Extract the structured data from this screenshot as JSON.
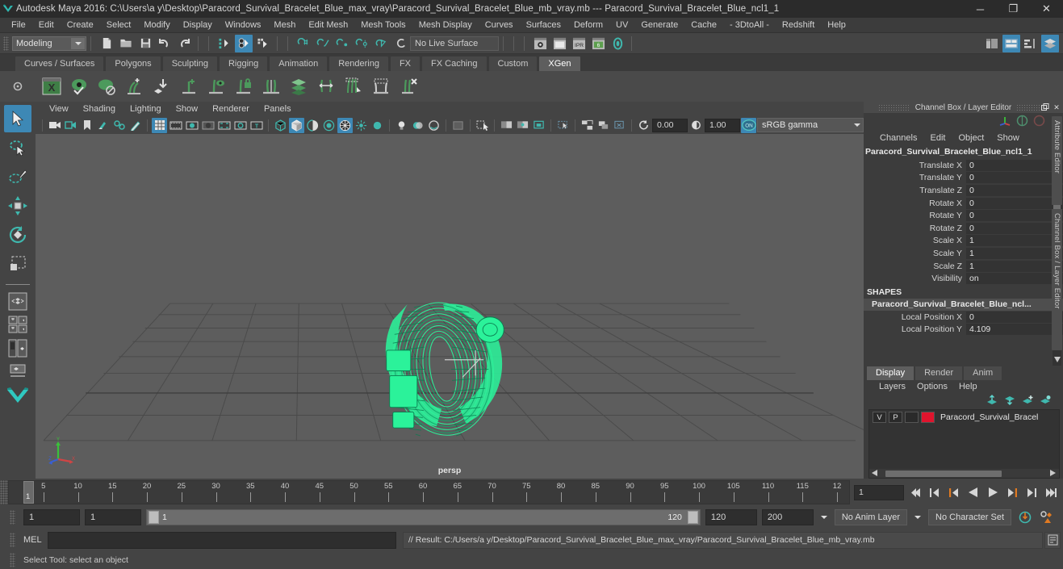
{
  "titlebar": {
    "app_icon": "maya-icon",
    "title": "Autodesk Maya 2016: C:\\Users\\a y\\Desktop\\Paracord_Survival_Bracelet_Blue_max_vray\\Paracord_Survival_Bracelet_Blue_mb_vray.mb  ---  Paracord_Survival_Bracelet_Blue_ncl1_1",
    "minimize": "─",
    "maximize": "❐",
    "close": "✕"
  },
  "menubar": {
    "items": [
      "File",
      "Edit",
      "Create",
      "Select",
      "Modify",
      "Display",
      "Windows",
      "Mesh",
      "Edit Mesh",
      "Mesh Tools",
      "Mesh Display",
      "Curves",
      "Surfaces",
      "Deform",
      "UV",
      "Generate",
      "Cache",
      "- 3DtoAll -",
      "Redshift",
      "Help"
    ]
  },
  "statusline": {
    "menuset": "Modeling",
    "live_surface": "No Live Surface",
    "numeric_input_a": "0.00",
    "numeric_input_b": "1.00",
    "color_space": "sRGB gamma",
    "icons": {
      "new_scene": "new-scene-icon",
      "open_scene": "open-scene-icon",
      "save_scene": "save-scene-icon",
      "undo": "undo-icon",
      "redo": "redo-icon",
      "select_hierarchy": "select-by-hierarchy-icon",
      "select_object": "select-by-object-type-icon",
      "select_component": "select-by-component-type-icon",
      "snap_grid": "snap-to-grid-icon",
      "snap_curve": "snap-to-curve-icon",
      "snap_point": "snap-to-point-icon",
      "snap_projected": "snap-to-projected-center-icon",
      "snap_view_plane": "snap-to-view-plane-icon",
      "make_live": "make-live-icon",
      "render_current": "render-current-frame-icon",
      "render_sequence": "render-sequence-icon",
      "ipr_render": "ipr-render-icon",
      "render_settings": "render-settings-icon",
      "hypershade": "hypershade-icon",
      "sidebar_toggle_attr": "show-attribute-editor-icon",
      "sidebar_toggle_tool": "show-tool-settings-icon",
      "sidebar_toggle_channel": "show-channel-box-icon"
    }
  },
  "shelf": {
    "tabs": [
      "Curves / Surfaces",
      "Polygons",
      "Sculpting",
      "Rigging",
      "Animation",
      "Rendering",
      "FX",
      "FX Caching",
      "Custom",
      "XGen"
    ],
    "active_tab": "XGen",
    "icons": [
      "xgen-window-icon",
      "xgen-preview-icon",
      "xgen-disable-preview-icon",
      "xgen-add-groom-icon",
      "xgen-place-icon",
      "xgen-add-density-icon",
      "xgen-show-guides-icon",
      "xgen-lock-guides-icon",
      "xgen-part-guides-icon",
      "xgen-layers-icon",
      "xgen-width-icon",
      "xgen-clump-icon",
      "xgen-region-icon",
      "xgen-delete-icon"
    ]
  },
  "toolbox": {
    "tools": [
      {
        "name": "select-tool-icon",
        "active": true
      },
      {
        "name": "lasso-select-tool-icon",
        "active": false
      },
      {
        "name": "paint-select-tool-icon",
        "active": false
      },
      {
        "name": "move-tool-icon",
        "active": false
      },
      {
        "name": "rotate-tool-icon",
        "active": false
      },
      {
        "name": "scale-tool-icon",
        "active": false
      }
    ],
    "layout_tools": [
      "single-perspective-view-icon",
      "four-view-layout-icon",
      "persp-outliner-layout-icon",
      "persp-graph-layout-icon"
    ]
  },
  "viewport": {
    "menus": [
      "View",
      "Shading",
      "Lighting",
      "Show",
      "Renderer",
      "Panels"
    ],
    "camera_label": "persp",
    "wireframe_color": "#2bf29a",
    "background_color": "#5d5d5d",
    "grid_color": "#4a4a4a",
    "toolbar_icons": [
      "select-camera-icon",
      "camera-attributes-icon",
      "bookmark-icon",
      "image-plane-icon",
      "two-d-pan-zoom-icon",
      "grease-pencil-icon",
      "grid-toggle-icon",
      "film-gate-icon",
      "resolution-gate-icon",
      "gate-mask-icon",
      "film-origin-icon",
      "field-chart-icon",
      "safe-title-icon",
      "wireframe-shading-icon",
      "smooth-shade-all-icon",
      "smooth-shade-selected-icon",
      "flat-shade-icon",
      "wireframe-on-shaded-icon",
      "use-default-material-icon",
      "shaded-texture-icon",
      "use-all-lights-icon",
      "shadows-icon",
      "ao-icon",
      "motion-blur-icon",
      "multisample-icon",
      "isolate-select-icon",
      "xray-icon",
      "xray-joints-icon",
      "xray-active-components-icon",
      "exposure-icon",
      "gamma-icon",
      "view-transform-enabled-icon"
    ],
    "exposure": "0.00",
    "gamma": "1.00",
    "view_transform": "sRGB gamma",
    "view_transform_toggle": "ON"
  },
  "channelbox": {
    "panel_title": "Channel Box / Layer Editor",
    "undock_icon": "undock-icon",
    "close_icon": "close-icon",
    "manip_icons": [
      "manipulator-icon",
      "no-manip-icon",
      "locator-icon"
    ],
    "menus": [
      "Channels",
      "Edit",
      "Object",
      "Show"
    ],
    "object_name": "Paracord_Survival_Bracelet_Blue_ncl1_1",
    "channels": [
      {
        "label": "Translate X",
        "value": "0"
      },
      {
        "label": "Translate Y",
        "value": "0"
      },
      {
        "label": "Translate Z",
        "value": "0"
      },
      {
        "label": "Rotate X",
        "value": "0"
      },
      {
        "label": "Rotate Y",
        "value": "0"
      },
      {
        "label": "Rotate Z",
        "value": "0"
      },
      {
        "label": "Scale X",
        "value": "1"
      },
      {
        "label": "Scale Y",
        "value": "1"
      },
      {
        "label": "Scale Z",
        "value": "1"
      },
      {
        "label": "Visibility",
        "value": "on"
      }
    ],
    "shapes_header": "SHAPES",
    "shape_name": "Paracord_Survival_Bracelet_Blue_ncl...",
    "shape_channels": [
      {
        "label": "Local Position X",
        "value": "0"
      },
      {
        "label": "Local Position Y",
        "value": "4.109"
      }
    ]
  },
  "layereditor": {
    "tabs": [
      "Display",
      "Render",
      "Anim"
    ],
    "active_tab": "Display",
    "menus": [
      "Layers",
      "Options",
      "Help"
    ],
    "toolbar_icons": [
      "move-layer-up-icon",
      "move-layer-down-icon",
      "new-layer-icon",
      "new-layer-from-selected-icon"
    ],
    "layers": [
      {
        "visibility": "V",
        "playback": "P",
        "shading": "",
        "color": "#e0142d",
        "name": "Paracord_Survival_Bracel"
      }
    ]
  },
  "right_tabs": [
    "Attribute Editor",
    "Channel Box / Layer Editor"
  ],
  "timeslider": {
    "tick_labels": [
      "5",
      "10",
      "15",
      "20",
      "25",
      "30",
      "35",
      "40",
      "45",
      "50",
      "55",
      "60",
      "65",
      "70",
      "75",
      "80",
      "85",
      "90",
      "95",
      "100",
      "105",
      "110",
      "115",
      "12"
    ],
    "current_frame_marker": "1",
    "current_frame_field": "1",
    "playback_icons": [
      "go-to-start-icon",
      "step-back-key-icon",
      "step-back-frame-icon",
      "play-backwards-icon",
      "play-forwards-icon",
      "step-forward-frame-icon",
      "step-forward-key-icon",
      "go-to-end-icon"
    ]
  },
  "rangeslider": {
    "anim_start": "1",
    "playback_start": "1",
    "range_start_label": "1",
    "range_end_label": "120",
    "playback_end": "120",
    "anim_end": "200",
    "anim_layer": "No Anim Layer",
    "character_set": "No Character Set",
    "auto_key_icon": "auto-keyframe-icon",
    "anim_prefs_icon": "animation-preferences-icon"
  },
  "commandline": {
    "language_label": "MEL",
    "input_value": "",
    "input_placeholder": "",
    "result_text": "// Result: C:/Users/a y/Desktop/Paracord_Survival_Bracelet_Blue_max_vray/Paracord_Survival_Bracelet_Blue_mb_vray.mb",
    "script_editor_icon": "script-editor-icon"
  },
  "helpline": {
    "text": "Select Tool: select an object"
  },
  "colors": {
    "accent_blue": "#3d88b5",
    "teal": "#3fb8ae",
    "xgen_green": "#4a9a5e",
    "wireframe_green": "#2bf29a",
    "layer_red": "#e0142d",
    "orange": "#e07a22"
  }
}
